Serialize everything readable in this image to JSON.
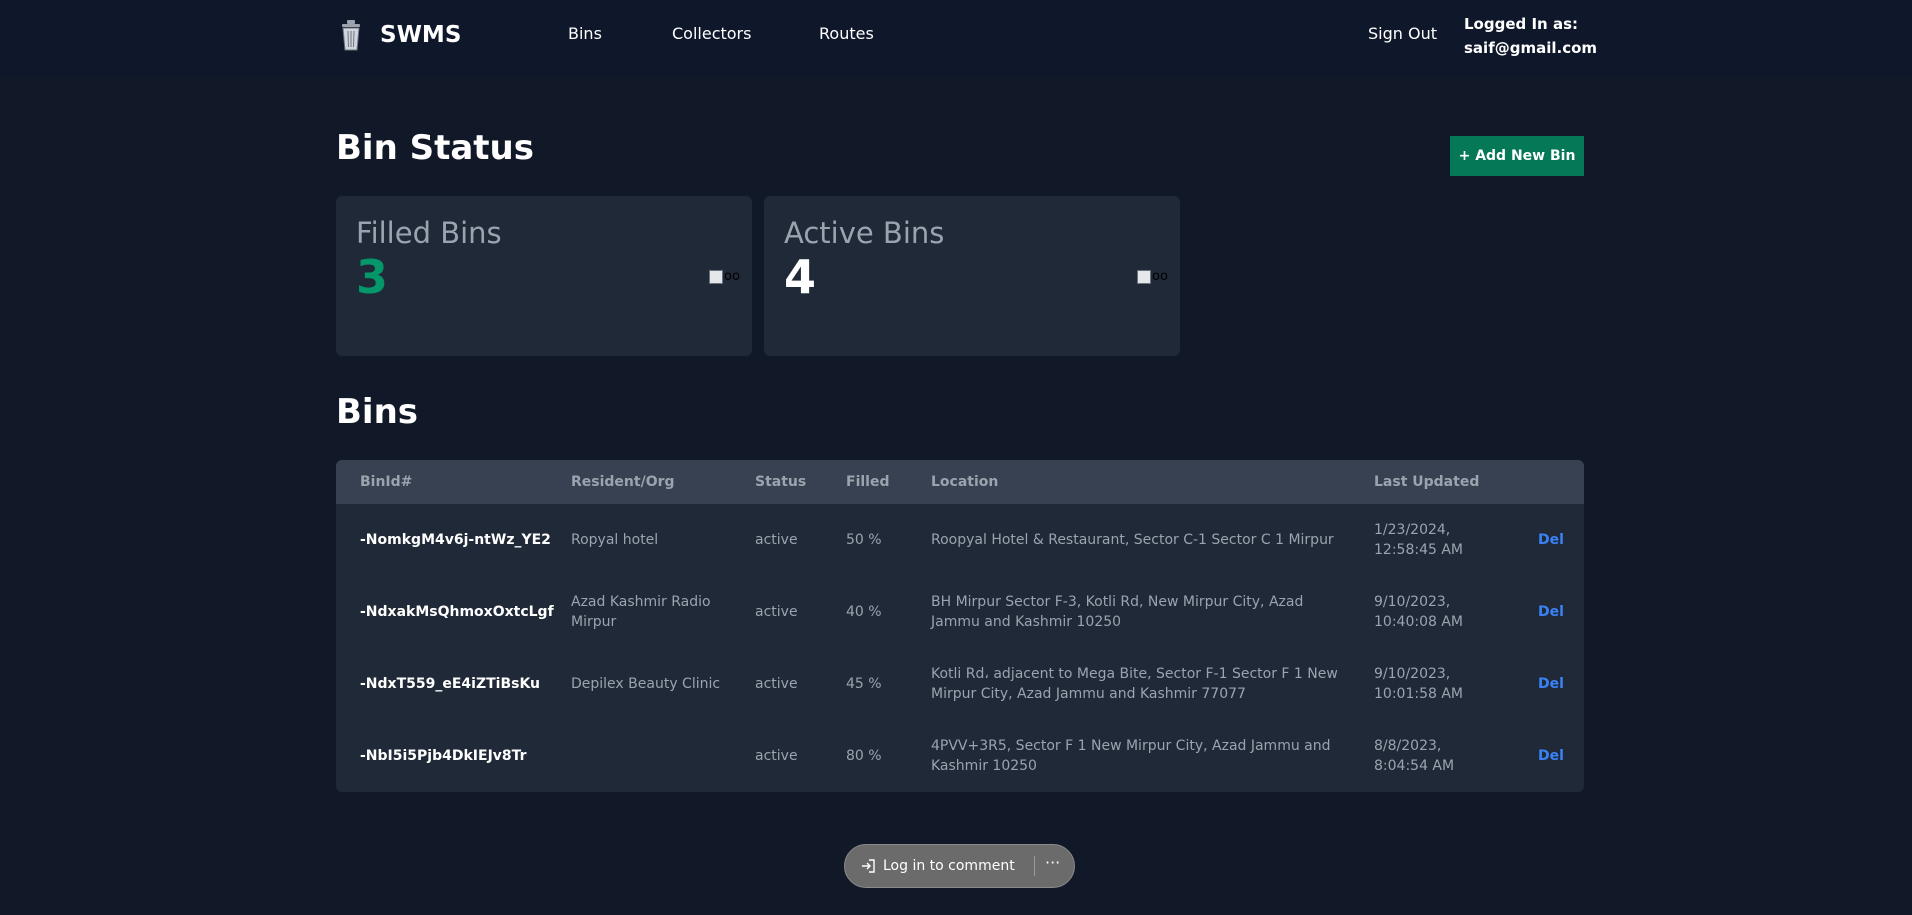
{
  "app": {
    "name": "SWMS"
  },
  "nav": {
    "links": [
      "Bins",
      "Collectors",
      "Routes"
    ],
    "sign_out": "Sign Out",
    "logged_in_label": "Logged In as:",
    "logged_in_email": "saif@gmail.com"
  },
  "page": {
    "title": "Bin Status",
    "add_button": "+ Add New Bin"
  },
  "cards": [
    {
      "label": "Filled Bins",
      "value": "3",
      "value_color": "#059669",
      "img_alt": "oo"
    },
    {
      "label": "Active Bins",
      "value": "4",
      "value_color": "#ffffff",
      "img_alt": "oo"
    }
  ],
  "bins": {
    "title": "Bins",
    "columns": [
      "BinId#",
      "Resident/Org",
      "Status",
      "Filled",
      "Location",
      "Last Updated"
    ],
    "rows": [
      {
        "id": "-NomkgM4v6j-ntWz_YE2",
        "resident": "Ropyal hotel",
        "status": "active",
        "filled": "50 %",
        "location": "Roopyal Hotel & Restaurant, Sector C-1 Sector C 1 Mirpur",
        "updated": "1/23/2024, 12:58:45 AM",
        "action": "Del"
      },
      {
        "id": "-NdxakMsQhmoxOxtcLgf",
        "resident": "Azad Kashmir Radio Mirpur",
        "status": "active",
        "filled": "40 %",
        "location": "BH Mirpur Sector F-3, Kotli Rd, New Mirpur City, Azad Jammu and Kashmir 10250",
        "updated": "9/10/2023, 10:40:08 AM",
        "action": "Del"
      },
      {
        "id": "-NdxT559_eE4iZTiBsKu",
        "resident": "Depilex Beauty Clinic",
        "status": "active",
        "filled": "45 %",
        "location": "Kotli Rd، adjacent to Mega Bite, Sector F-1 Sector F 1 New Mirpur City, Azad Jammu and Kashmir 77077",
        "updated": "9/10/2023, 10:01:58 AM",
        "action": "Del"
      },
      {
        "id": "-NbI5i5Pjb4DkIEJv8Tr",
        "resident": "",
        "status": "active",
        "filled": "80 %",
        "location": "4PVV+3R5, Sector F 1 New Mirpur City, Azad Jammu and Kashmir 10250",
        "updated": "8/8/2023, 8:04:54 AM",
        "action": "Del"
      }
    ]
  },
  "comment_bar": {
    "login_label": "Log in to comment",
    "more_label": "···"
  },
  "colors": {
    "background": "#111827",
    "navbar": "#0f172a",
    "card": "#1f2937",
    "accent_green": "#047857",
    "link_blue": "#3b82f6"
  }
}
